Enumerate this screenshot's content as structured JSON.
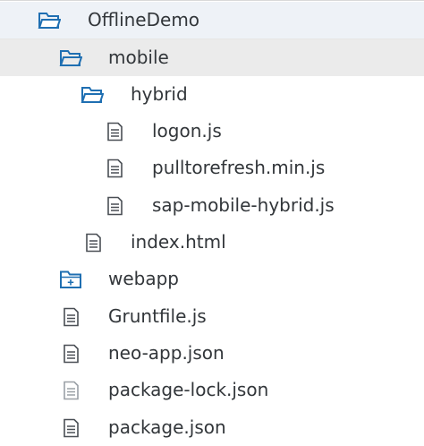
{
  "tree": {
    "items": [
      {
        "label": "OfflineDemo",
        "icon": "folder-open-icon"
      },
      {
        "label": "mobile",
        "icon": "folder-open-icon"
      },
      {
        "label": "hybrid",
        "icon": "folder-open-icon"
      },
      {
        "label": "logon.js",
        "icon": "file-icon"
      },
      {
        "label": "pulltorefresh.min.js",
        "icon": "file-icon"
      },
      {
        "label": "sap-mobile-hybrid.js",
        "icon": "file-icon"
      },
      {
        "label": "index.html",
        "icon": "file-icon"
      },
      {
        "label": "webapp",
        "icon": "folder-add-icon"
      },
      {
        "label": "Gruntfile.js",
        "icon": "file-icon"
      },
      {
        "label": "neo-app.json",
        "icon": "file-icon"
      },
      {
        "label": "package-lock.json",
        "icon": "file-icon"
      },
      {
        "label": "package.json",
        "icon": "file-icon"
      }
    ]
  },
  "colors": {
    "folder": "#1f6fb2",
    "file": "#4a4f55",
    "file_faded": "#9aa0a6",
    "text": "#32363a",
    "selected_row": "#ebebeb",
    "root_row": "#eef2f7"
  }
}
